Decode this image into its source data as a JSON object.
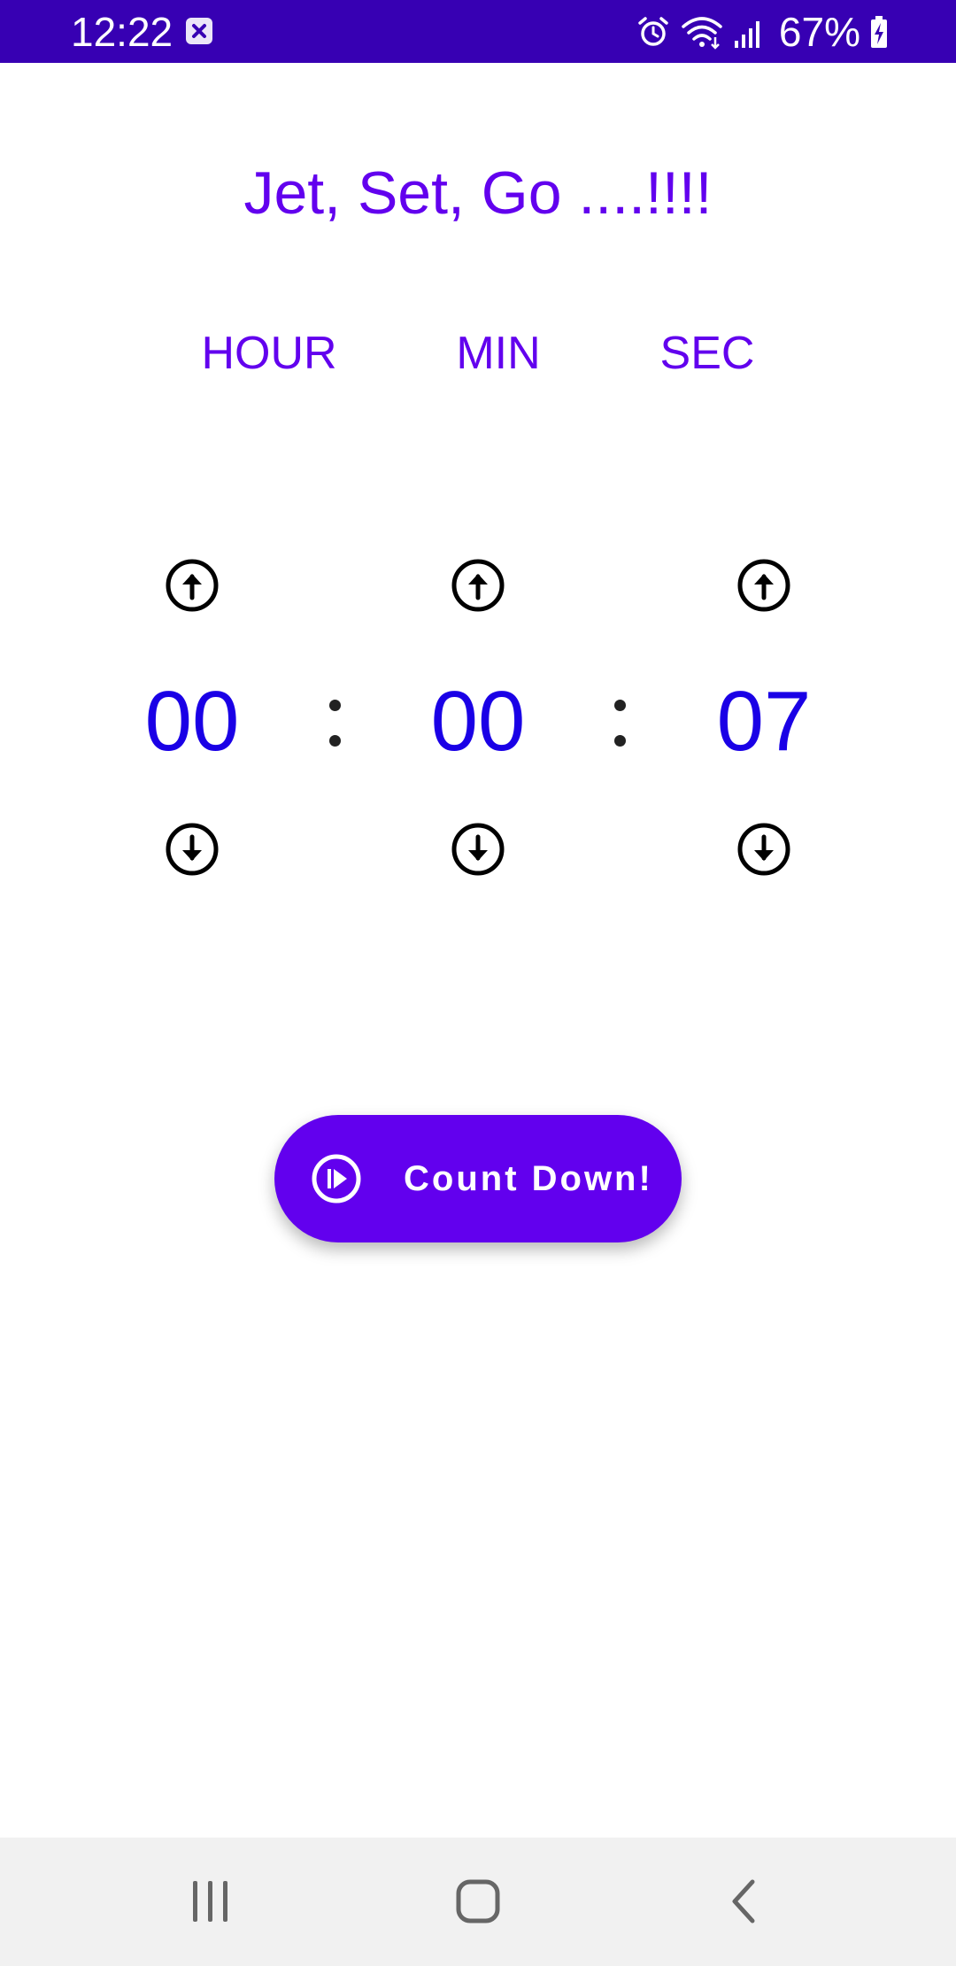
{
  "status_bar": {
    "time": "12:22",
    "battery": "67%",
    "icons": [
      "notification-x-icon",
      "alarm-icon",
      "wifi-icon",
      "signal-icon",
      "battery-charging-icon"
    ],
    "background": "#3700B3"
  },
  "app": {
    "title": "Jet, Set, Go ....!!!!",
    "accent_color": "#6200EE",
    "digit_color": "#1A00E6"
  },
  "labels": {
    "hour": "HOUR",
    "min": "MIN",
    "sec": "SEC"
  },
  "time": {
    "hours": "00",
    "minutes": "00",
    "seconds": "07"
  },
  "controls": {
    "up_icon": "arrow-up-circle-icon",
    "down_icon": "arrow-down-circle-icon"
  },
  "button": {
    "label": "Count Down!",
    "icon": "play-circle-icon"
  },
  "nav": {
    "items": [
      "recents",
      "home",
      "back"
    ]
  }
}
